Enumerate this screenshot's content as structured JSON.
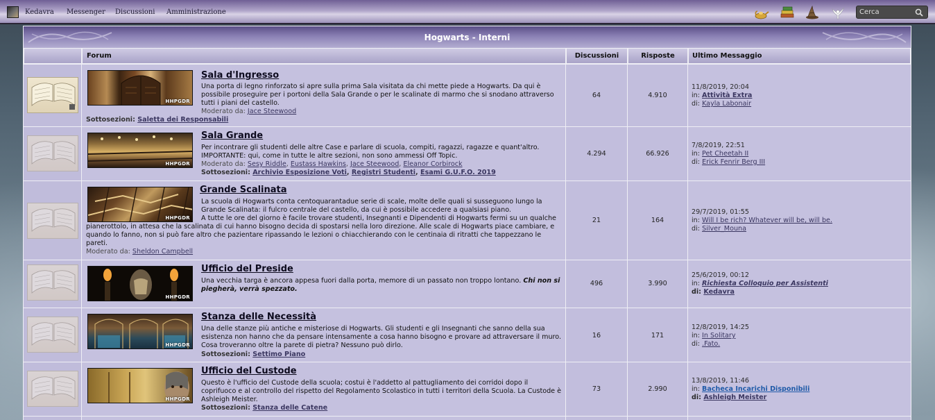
{
  "topbar": {
    "username": "Kedavra",
    "nav": [
      "Messenger",
      "Discussioni",
      "Amministrazione"
    ],
    "icons": [
      "lamp-icon",
      "books-icon",
      "sorting-hat-icon",
      "owl-icon"
    ],
    "search_placeholder": "Cerca"
  },
  "category": {
    "title": "Hogwarts - Interni",
    "columns": {
      "forum": "Forum",
      "discussioni": "Discussioni",
      "risposte": "Risposte",
      "ultimo": "Ultimo Messaggio"
    }
  },
  "labels": {
    "moderato": "Moderato da:",
    "sottosezioni": "Sottosezioni:",
    "in": "in:",
    "di": "di:",
    "watermark": "HHPGDR"
  },
  "forums": [
    {
      "title": "Sala d'Ingresso",
      "desc": "Una porta di legno rinforzato si apre sulla prima Sala visitata da chi mette piede a Hogwarts. Da qui è possibile proseguire per i portoni della Sala Grande o per le scalinate di marmo che si snodano attraverso tutti i piani del castello.",
      "moderators": [
        "Jace Steewood"
      ],
      "subsections": [
        "Saletta dei Responsabili"
      ],
      "discussioni": "64",
      "risposte": "4.910",
      "last_date": "11/8/2019, 20:04",
      "last_topic": "Attività Extra",
      "last_author": "Kayla Labonair"
    },
    {
      "title": "Sala Grande",
      "desc": "Per incontrare gli studenti delle altre Case e parlare di scuola, compiti, ragazzi, ragazze e quant'altro.",
      "desc2": "IMPORTANTE: qui, come in tutte le altre sezioni, non sono ammessi Off Topic.",
      "moderators": [
        "Sesy Riddle",
        "Eustass Hawkins",
        "Jace Steewood",
        "Eleanor Corbirock"
      ],
      "subsections": [
        "Archivio Esposizione Voti",
        "Registri Studenti",
        "Esami G.U.F.O. 2019"
      ],
      "discussioni": "4.294",
      "risposte": "66.926",
      "last_date": "7/8/2019, 22:51",
      "last_topic": "Pet Cheetah II",
      "last_author": "Erick Fenrir Berg III"
    },
    {
      "title": "Grande Scalinata",
      "desc": "La scuola di Hogwarts conta centoquarantadue serie di scale, molte delle quali si susseguono lungo la Grande Scalinata: il fulcro centrale del castello, da cui è possibile accedere a qualsiasi piano.",
      "desc2": "A tutte le ore del giorno è facile trovare studenti, Insegnanti e Dipendenti di Hogwarts fermi su un qualche pianerottolo, in attesa che la scalinata di cui hanno bisogno decida di spostarsi nella loro direzione. Alle scale di Hogwarts piace cambiare, e quando lo fanno, non si può fare altro che pazientare ripassando le lezioni o chiacchierando con le centinaia di ritratti che tappezzano le pareti.",
      "moderators": [
        "Sheldon Campbell"
      ],
      "subsections": [],
      "discussioni": "21",
      "risposte": "164",
      "last_date": "29/7/2019, 01:55",
      "last_topic": "Will I be rich? Whatever will be, will be.",
      "last_author": "Silver_Mouna"
    },
    {
      "title": "Ufficio del Preside",
      "desc": "Una vecchia targa è ancora appesa fuori dalla porta, memore di un passato non troppo lontano.",
      "desc_em": "Chi non si piegherà, verrà spezzato.",
      "moderators": [],
      "subsections": [],
      "discussioni": "496",
      "risposte": "3.990",
      "last_date": "25/6/2019, 00:12",
      "last_topic": "Richiesta Colloquio per Assistenti",
      "last_author": "Kedavra"
    },
    {
      "title": "Stanza delle Necessità",
      "desc": "Una delle stanze più antiche e misteriose di Hogwarts. Gli studenti e gli Insegnanti che sanno della sua esistenza non hanno che da pensare intensamente a cosa hanno bisogno e provare ad attraversare il muro. Cosa troveranno oltre la parete di pietra? Nessuno può dirlo.",
      "moderators": [],
      "subsections": [
        "Settimo Piano"
      ],
      "discussioni": "16",
      "risposte": "171",
      "last_date": "12/8/2019, 14:25",
      "last_topic": "In Solitary",
      "last_author": ".Fato."
    },
    {
      "title": "Ufficio del Custode",
      "desc": "Questo è l'ufficio del Custode della scuola; costui è l'addetto al pattugliamento dei corridoi dopo il coprifuoco e al controllo del rispetto del Regolamento Scolastico in tutti i territori della Scuola. La Custode è Ashleigh Meister.",
      "moderators": [],
      "subsections": [
        "Stanza delle Catene"
      ],
      "discussioni": "73",
      "risposte": "2.990",
      "last_date": "13/8/2019, 11:46",
      "last_topic": "Bacheca Incarichi Disponibili",
      "last_author": "Ashleigh Meister"
    }
  ]
}
